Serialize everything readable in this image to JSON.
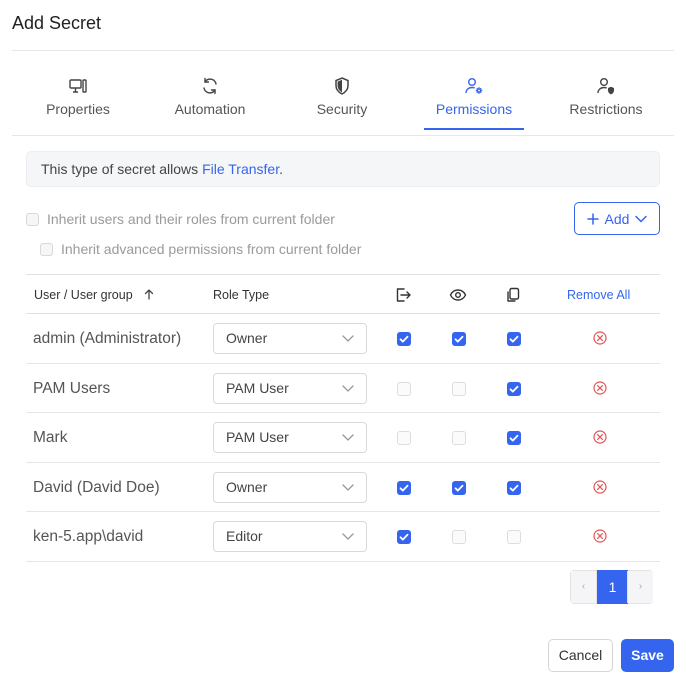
{
  "dialog": {
    "title": "Add Secret"
  },
  "tabs": [
    {
      "label": "Properties",
      "icon": "monitor-icon"
    },
    {
      "label": "Automation",
      "icon": "refresh-icon"
    },
    {
      "label": "Security",
      "icon": "shield-icon"
    },
    {
      "label": "Permissions",
      "icon": "user-gear-icon",
      "active": true
    },
    {
      "label": "Restrictions",
      "icon": "user-shield-icon"
    }
  ],
  "info": {
    "prefix": "This type of secret allows ",
    "link": "File Transfer",
    "suffix": "."
  },
  "inherit": {
    "users_label": "Inherit users and their roles from current folder",
    "advanced_label": "Inherit advanced permissions from current folder"
  },
  "add_button": {
    "label": "Add"
  },
  "table": {
    "headers": {
      "user": "User / User group",
      "role": "Role Type",
      "remove_all": "Remove All"
    },
    "rows": [
      {
        "user": "admin (Administrator)",
        "role": "Owner",
        "perms": [
          true,
          true,
          true
        ]
      },
      {
        "user": "PAM Users",
        "role": "PAM User",
        "perms": [
          false,
          false,
          true
        ]
      },
      {
        "user": "Mark",
        "role": "PAM User",
        "perms": [
          false,
          false,
          true
        ]
      },
      {
        "user": "David (David Doe)",
        "role": "Owner",
        "perms": [
          true,
          true,
          true
        ]
      },
      {
        "user": "ken-5.app\\david",
        "role": "Editor",
        "perms": [
          true,
          false,
          false
        ]
      }
    ]
  },
  "pagination": {
    "prev": "‹",
    "current": "1",
    "next": "›"
  },
  "footer": {
    "cancel_label": "Cancel",
    "save_label": "Save"
  },
  "colors": {
    "accent": "#3565ee",
    "remove": "#e25555"
  }
}
